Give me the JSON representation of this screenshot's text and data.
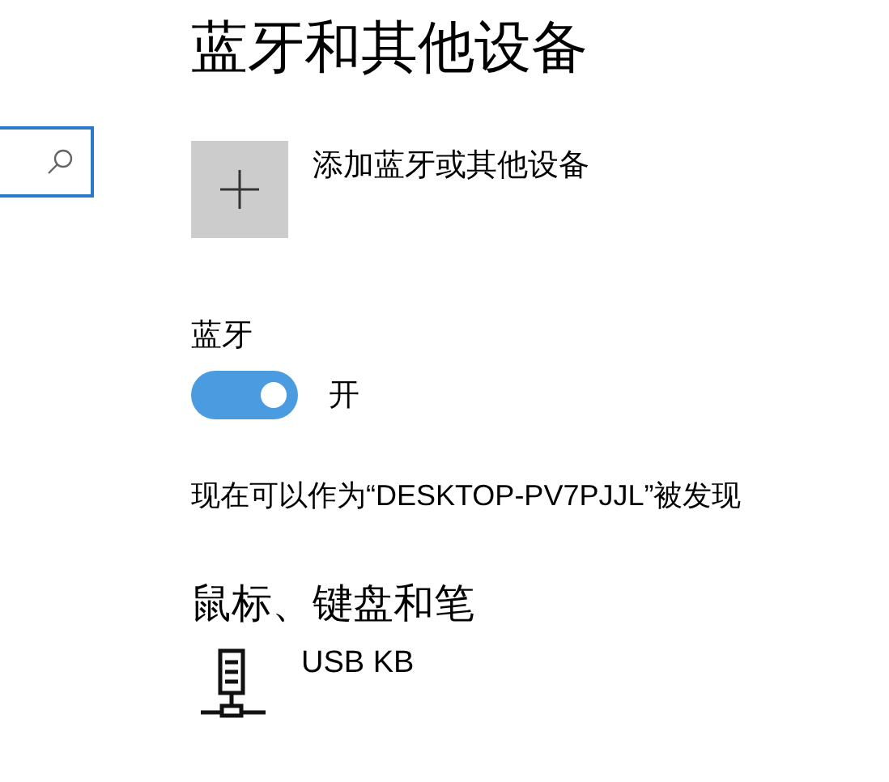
{
  "title": "蓝牙和其他设备",
  "add_device": {
    "label": "添加蓝牙或其他设备"
  },
  "bluetooth": {
    "label": "蓝牙",
    "on": true,
    "state_label": "开"
  },
  "discoverable_text": "现在可以作为“DESKTOP-PV7PJJL”被发现",
  "section_title": "鼠标、键盘和笔",
  "devices": [
    {
      "name": "USB KB"
    }
  ]
}
